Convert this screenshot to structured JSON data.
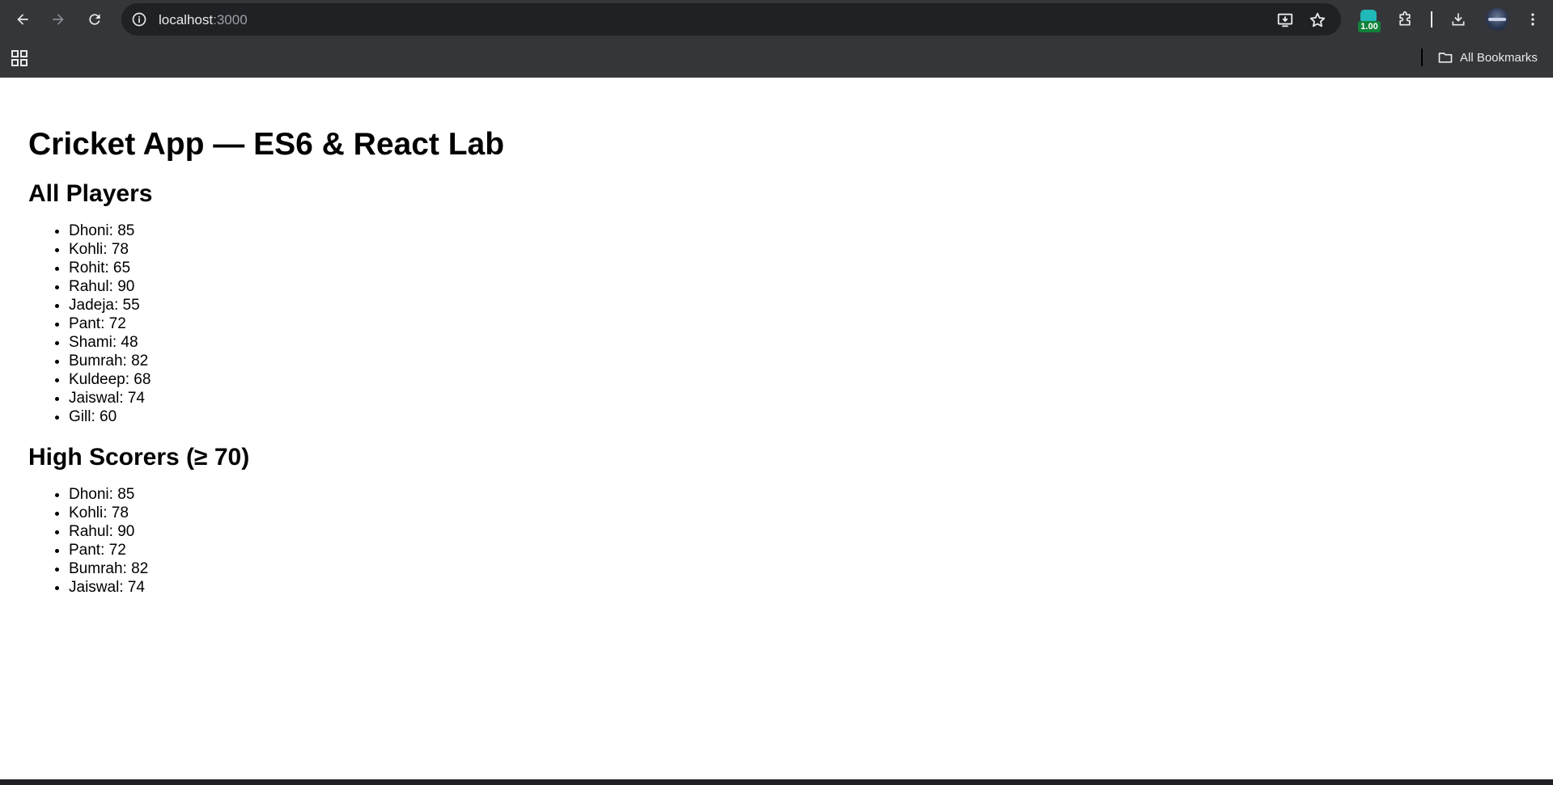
{
  "browser": {
    "url_host": "localhost",
    "url_port": ":3000",
    "extension_badge": "1.00",
    "bookmarks_label": "All Bookmarks"
  },
  "page": {
    "title": "Cricket App — ES6 & React Lab",
    "all_players": {
      "heading": "All Players",
      "items": [
        "Dhoni: 85",
        "Kohli: 78",
        "Rohit: 65",
        "Rahul: 90",
        "Jadeja: 55",
        "Pant: 72",
        "Shami: 48",
        "Bumrah: 82",
        "Kuldeep: 68",
        "Jaiswal: 74",
        "Gill: 60"
      ]
    },
    "high_scorers": {
      "heading": "High Scorers (≥ 70)",
      "items": [
        "Dhoni: 85",
        "Kohli: 78",
        "Rahul: 90",
        "Pant: 72",
        "Bumrah: 82",
        "Jaiswal: 74"
      ]
    }
  }
}
